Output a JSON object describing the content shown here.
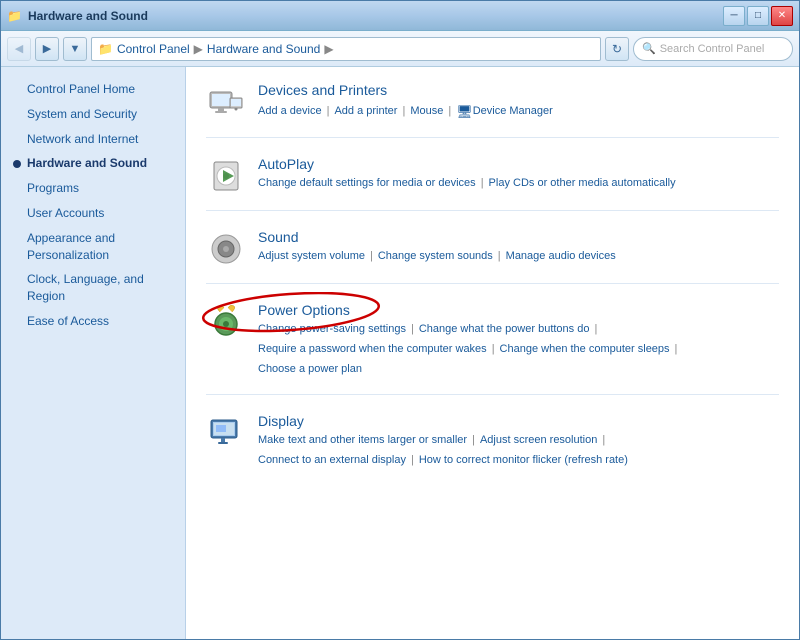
{
  "window": {
    "title": "Hardware and Sound",
    "title_icon": "📁"
  },
  "title_buttons": {
    "minimize": "─",
    "restore": "□",
    "close": "✕"
  },
  "address_bar": {
    "folder_icon": "📁",
    "crumbs": [
      "Control Panel",
      "Hardware and Sound",
      ""
    ],
    "refresh_icon": "↻",
    "search_placeholder": "Search Control Panel",
    "search_icon": "🔍"
  },
  "nav": {
    "back_icon": "◀",
    "forward_icon": "▶"
  },
  "sidebar": {
    "items": [
      {
        "label": "Control Panel Home",
        "active": false,
        "bullet": false
      },
      {
        "label": "System and Security",
        "active": false,
        "bullet": false
      },
      {
        "label": "Network and Internet",
        "active": false,
        "bullet": false
      },
      {
        "label": "Hardware and Sound",
        "active": true,
        "bullet": true
      },
      {
        "label": "Programs",
        "active": false,
        "bullet": false
      },
      {
        "label": "User Accounts",
        "active": false,
        "bullet": false
      },
      {
        "label": "Appearance and Personalization",
        "active": false,
        "bullet": false
      },
      {
        "label": "Clock, Language, and Region",
        "active": false,
        "bullet": false
      },
      {
        "label": "Ease of Access",
        "active": false,
        "bullet": false
      }
    ]
  },
  "sections": [
    {
      "id": "devices",
      "title": "Devices and Printers",
      "links_row1": [
        {
          "label": "Add a device",
          "sep": true
        },
        {
          "label": "Add a printer",
          "sep": true
        },
        {
          "label": "Mouse",
          "sep": true
        },
        {
          "label": "Device Manager",
          "sep": false
        }
      ],
      "links_row2": []
    },
    {
      "id": "autoplay",
      "title": "AutoPlay",
      "links_row1": [
        {
          "label": "Change default settings for media or devices",
          "sep": true
        },
        {
          "label": "Play CDs or other media automatically",
          "sep": false
        }
      ],
      "links_row2": []
    },
    {
      "id": "sound",
      "title": "Sound",
      "links_row1": [
        {
          "label": "Adjust system volume",
          "sep": true
        },
        {
          "label": "Change system sounds",
          "sep": true
        },
        {
          "label": "Manage audio devices",
          "sep": false
        }
      ],
      "links_row2": []
    },
    {
      "id": "power",
      "title": "Power Options",
      "links_row1": [
        {
          "label": "Change power-saving settings",
          "sep": true
        },
        {
          "label": "Change what the power buttons do",
          "sep": false
        }
      ],
      "links_row2": [
        {
          "label": "Require a password when the computer wakes",
          "sep": true
        },
        {
          "label": "Change when the computer sleeps",
          "sep": false
        }
      ],
      "links_row3": [
        {
          "label": "Choose a power plan",
          "sep": false
        }
      ]
    },
    {
      "id": "display",
      "title": "Display",
      "links_row1": [
        {
          "label": "Make text and other items larger or smaller",
          "sep": true
        },
        {
          "label": "Adjust screen resolution",
          "sep": false
        }
      ],
      "links_row2": [
        {
          "label": "Connect to an external display",
          "sep": true
        },
        {
          "label": "How to correct monitor flicker (refresh rate)",
          "sep": false
        }
      ]
    }
  ]
}
